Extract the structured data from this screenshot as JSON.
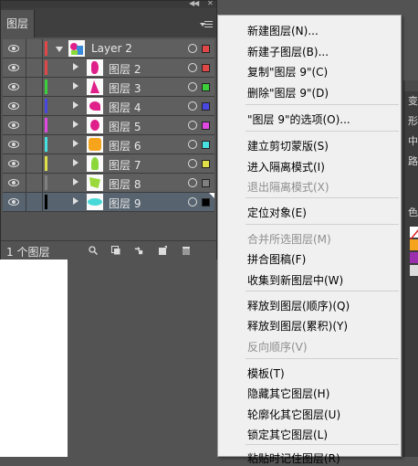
{
  "layers_panel": {
    "tab_label": "图层",
    "status_text": "1 个图层",
    "parent_layer": {
      "name": "Layer 2",
      "color": "#e04848"
    },
    "sublayers": [
      {
        "name": "图层 2",
        "color": "#e04848",
        "selected": false
      },
      {
        "name": "图层 3",
        "color": "#3ccf3c",
        "selected": false
      },
      {
        "name": "图层 4",
        "color": "#4848e0",
        "selected": false
      },
      {
        "name": "图层 5",
        "color": "#e048e0",
        "selected": false
      },
      {
        "name": "图层 6",
        "color": "#48e0e0",
        "selected": false
      },
      {
        "name": "图层 7",
        "color": "#e0e048",
        "selected": false
      },
      {
        "name": "图层 8",
        "color": "#808080",
        "selected": false
      },
      {
        "name": "图层 9",
        "color": "#000000",
        "selected": true
      }
    ],
    "footer_icons": [
      "locate-object-icon",
      "make-clipping-mask-icon",
      "create-sublayer-icon",
      "new-layer-icon",
      "delete-icon"
    ]
  },
  "context_menu": {
    "items": [
      {
        "label": "新建图层(N)...",
        "disabled": false
      },
      {
        "label": "新建子图层(B)...",
        "disabled": false
      },
      {
        "label": "复制\"图层 9\"(C)",
        "disabled": false
      },
      {
        "label": "删除\"图层 9\"(D)",
        "disabled": false
      },
      {
        "label": "\"图层 9\"的选项(O)...",
        "disabled": false
      },
      {
        "label": "建立剪切蒙版(S)",
        "disabled": false
      },
      {
        "label": "进入隔离模式(I)",
        "disabled": false
      },
      {
        "label": "退出隔离模式(X)",
        "disabled": true
      },
      {
        "label": "定位对象(E)",
        "disabled": false
      },
      {
        "label": "合并所选图层(M)",
        "disabled": true
      },
      {
        "label": "拼合图稿(F)",
        "disabled": false
      },
      {
        "label": "收集到新图层中(W)",
        "disabled": false
      },
      {
        "label": "释放到图层(顺序)(Q)",
        "disabled": false
      },
      {
        "label": "释放到图层(累积)(Y)",
        "disabled": false
      },
      {
        "label": "反向顺序(V)",
        "disabled": true
      },
      {
        "label": "模板(T)",
        "disabled": false
      },
      {
        "label": "隐藏其它图层(H)",
        "disabled": false
      },
      {
        "label": "轮廓化其它图层(U)",
        "disabled": false
      },
      {
        "label": "锁定其它图层(L)",
        "disabled": false
      },
      {
        "label": "粘贴时记住图层(R)",
        "disabled": false
      }
    ]
  },
  "right_panel": {
    "labels": [
      "变",
      "形",
      "中",
      "路",
      "色"
    ],
    "swatches": [
      "#ffffff",
      "#f7a41d",
      "#9b2fae",
      "#ffffff"
    ]
  },
  "colors": {
    "panel_bg": "#535353",
    "selected_row": "#576470",
    "menu_bg": "#f0f0f0"
  }
}
